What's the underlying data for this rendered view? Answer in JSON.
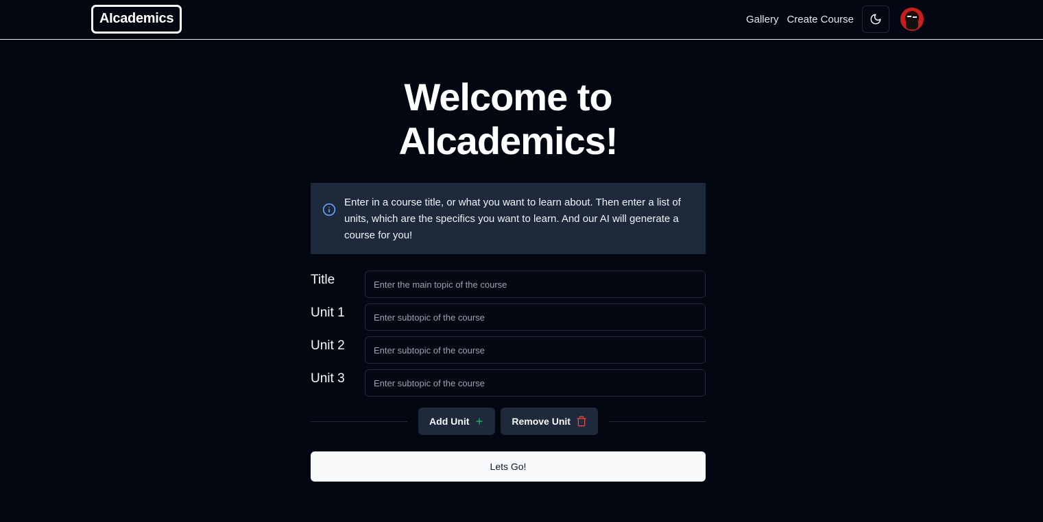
{
  "brand": {
    "name": "AIcademics"
  },
  "nav": {
    "links": [
      "Gallery",
      "Create Course"
    ],
    "theme_toggle_icon": "moon-icon",
    "avatar_icon": "user-avatar"
  },
  "hero": {
    "line1": "Welcome to",
    "line2": "AIcademics!"
  },
  "info": {
    "icon": "info-icon",
    "text": "Enter in a course title, or what you want to learn about. Then enter a list of units, which are the specifics you want to learn. And our AI will generate a course for you!"
  },
  "form": {
    "fields": [
      {
        "label": "Title",
        "placeholder": "Enter the main topic of the course",
        "value": ""
      },
      {
        "label": "Unit 1",
        "placeholder": "Enter subtopic of the course",
        "value": ""
      },
      {
        "label": "Unit 2",
        "placeholder": "Enter subtopic of the course",
        "value": ""
      },
      {
        "label": "Unit 3",
        "placeholder": "Enter subtopic of the course",
        "value": ""
      }
    ],
    "add_unit": {
      "label": "Add Unit",
      "icon": "plus-icon",
      "icon_color": "#22c55e"
    },
    "remove_unit": {
      "label": "Remove Unit",
      "icon": "trash-icon",
      "icon_color": "#ef4444"
    },
    "submit": {
      "label": "Lets Go!"
    }
  },
  "colors": {
    "background": "#030712",
    "panel": "#1e293b",
    "info_icon": "#60a5fa",
    "primary_button": "#f8fafc"
  }
}
